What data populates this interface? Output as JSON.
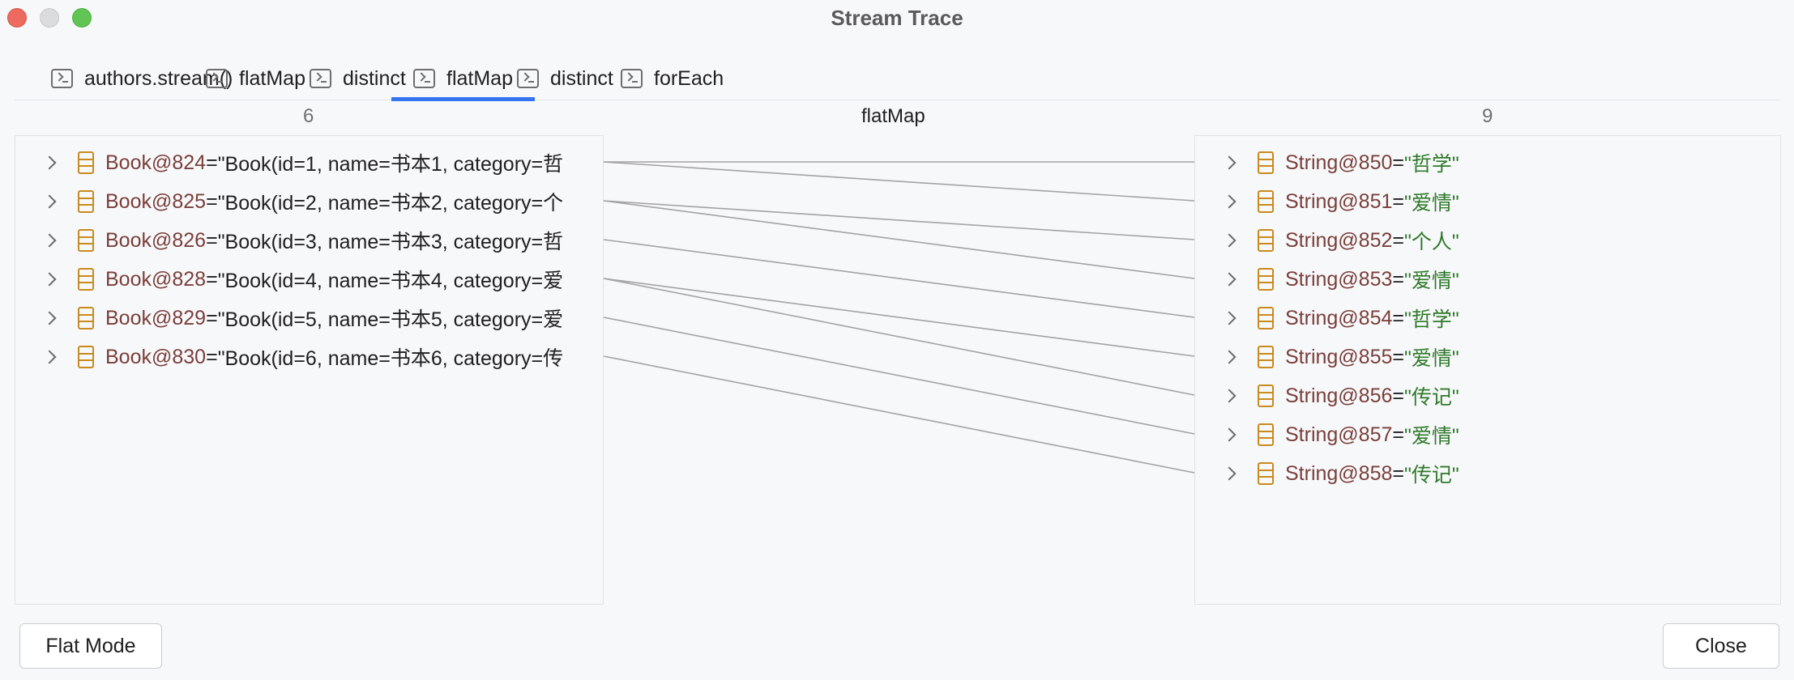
{
  "window": {
    "title": "Stream Trace"
  },
  "tabs": [
    {
      "label": "authors.stream()",
      "icon": "terminal-icon"
    },
    {
      "label": "flatMap",
      "icon": "terminal-icon"
    },
    {
      "label": "distinct",
      "icon": "terminal-icon"
    },
    {
      "label": "flatMap",
      "icon": "terminal-icon",
      "active": true
    },
    {
      "label": "distinct",
      "icon": "terminal-icon"
    },
    {
      "label": "forEach",
      "icon": "terminal-icon"
    }
  ],
  "columns": {
    "left_count": "6",
    "operation": "flatMap",
    "right_count": "9"
  },
  "left_items": [
    {
      "name": "Book@824",
      "eq": " = ",
      "value": "\"Book(id=1, name=书本1, category=哲"
    },
    {
      "name": "Book@825",
      "eq": " = ",
      "value": "\"Book(id=2, name=书本2, category=个"
    },
    {
      "name": "Book@826",
      "eq": " = ",
      "value": "\"Book(id=3, name=书本3, category=哲"
    },
    {
      "name": "Book@828",
      "eq": " = ",
      "value": "\"Book(id=4, name=书本4, category=爱"
    },
    {
      "name": "Book@829",
      "eq": " = ",
      "value": "\"Book(id=5, name=书本5, category=爱"
    },
    {
      "name": "Book@830",
      "eq": " = ",
      "value": "\"Book(id=6, name=书本6, category=传"
    }
  ],
  "right_items": [
    {
      "name": "String@850",
      "eq": " = ",
      "value": "\"哲学\""
    },
    {
      "name": "String@851",
      "eq": " = ",
      "value": "\"爱情\""
    },
    {
      "name": "String@852",
      "eq": " = ",
      "value": "\"个人\""
    },
    {
      "name": "String@853",
      "eq": " = ",
      "value": "\"爱情\""
    },
    {
      "name": "String@854",
      "eq": " = ",
      "value": "\"哲学\""
    },
    {
      "name": "String@855",
      "eq": " = ",
      "value": "\"爱情\""
    },
    {
      "name": "String@856",
      "eq": " = ",
      "value": "\"传记\""
    },
    {
      "name": "String@857",
      "eq": " = ",
      "value": "\"爱情\""
    },
    {
      "name": "String@858",
      "eq": " = ",
      "value": "\"传记\""
    }
  ],
  "mappings": [
    [
      0,
      0
    ],
    [
      0,
      1
    ],
    [
      1,
      2
    ],
    [
      1,
      3
    ],
    [
      2,
      4
    ],
    [
      3,
      5
    ],
    [
      3,
      6
    ],
    [
      4,
      7
    ],
    [
      5,
      8
    ]
  ],
  "buttons": {
    "flat_mode": "Flat Mode",
    "close": "Close"
  },
  "colors": {
    "accent": "#3574f0",
    "object_name": "#7a3f3a",
    "string_value": "#2f7a2a",
    "object_icon": "#c98a1e"
  }
}
